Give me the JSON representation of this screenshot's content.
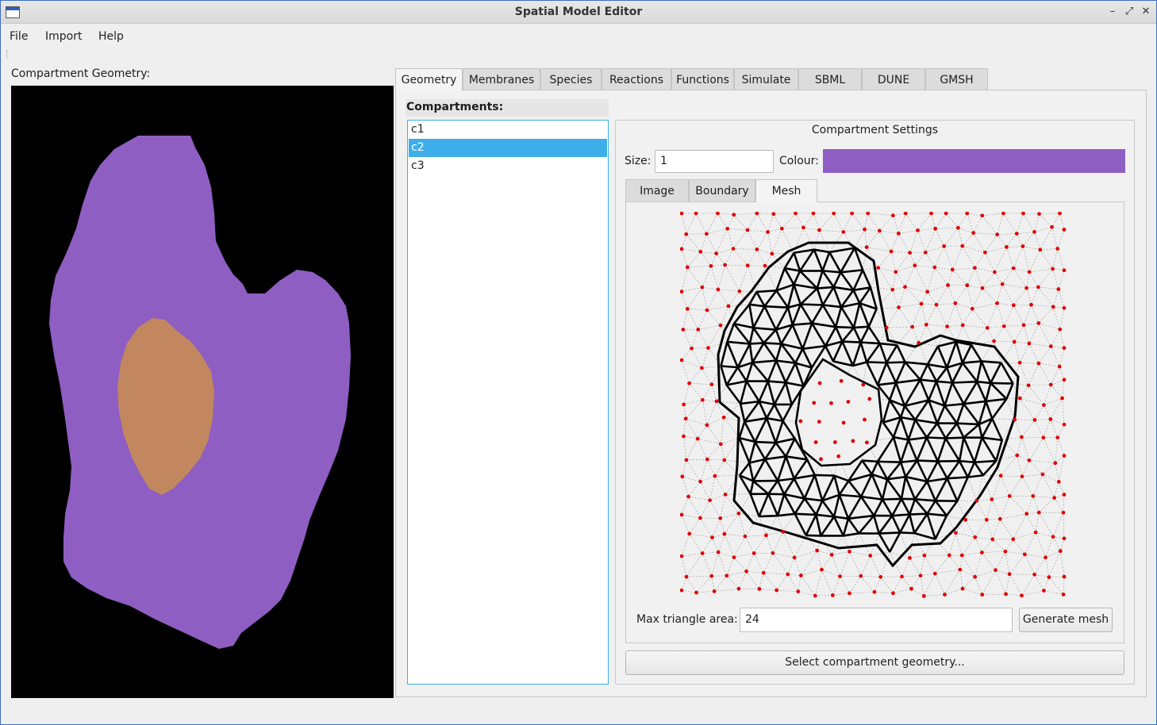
{
  "window": {
    "title": "Spatial Model Editor"
  },
  "menu": [
    "File",
    "Import",
    "Help"
  ],
  "geometry": {
    "label": "Compartment Geometry:",
    "colors": {
      "background": "#000000",
      "c2": "#8f5ec2",
      "c3": "#c2875e"
    }
  },
  "tabs": [
    "Geometry",
    "Membranes",
    "Species",
    "Reactions",
    "Functions",
    "Simulate",
    "SBML",
    "DUNE",
    "GMSH"
  ],
  "active_tab": "Geometry",
  "compartments": {
    "label": "Compartments:",
    "items": [
      "c1",
      "c2",
      "c3"
    ],
    "selected": "c2"
  },
  "settings": {
    "title": "Compartment Settings",
    "size_label": "Size:",
    "size_value": "1",
    "colour_label": "Colour:",
    "colour_value": "#8f5ec2",
    "subtabs": [
      "Image",
      "Boundary",
      "Mesh"
    ],
    "active_subtab": "Mesh",
    "max_area_label": "Max triangle area:",
    "max_area_value": "24",
    "generate_button": "Generate mesh",
    "select_geometry_button": "Select compartment geometry..."
  }
}
